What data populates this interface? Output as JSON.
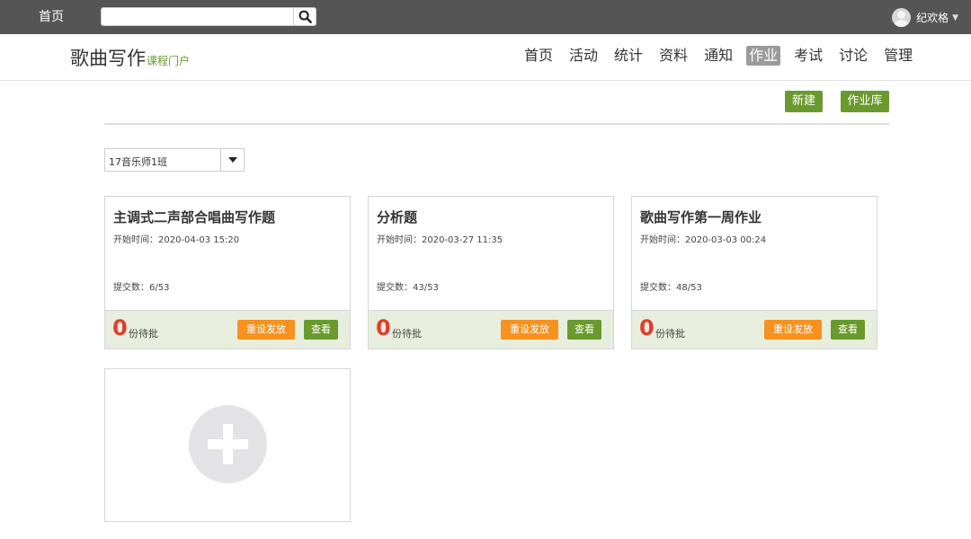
{
  "topbar": {
    "home_label": "首页",
    "search_placeholder": "",
    "user_name": "纪欢格"
  },
  "header": {
    "course_title": "歌曲写作",
    "course_subtitle": "课程门户",
    "nav": [
      "首页",
      "活动",
      "统计",
      "资料",
      "通知",
      "作业",
      "考试",
      "讨论",
      "管理"
    ],
    "active_nav": "作业"
  },
  "actions": {
    "new_label": "新建",
    "library_label": "作业库"
  },
  "class_select": {
    "value": "17音乐师1班"
  },
  "assignments": [
    {
      "title": "主调式二声部合唱曲写作题",
      "start": "开始时间：2020-04-03 15:20",
      "submitted": "提交数：6/53",
      "pending": "0",
      "pending_label": "份待批",
      "reset_label": "重设发放",
      "view_label": "查看"
    },
    {
      "title": "分析题",
      "start": "开始时间：2020-03-27 11:35",
      "submitted": "提交数：43/53",
      "pending": "0",
      "pending_label": "份待批",
      "reset_label": "重设发放",
      "view_label": "查看"
    },
    {
      "title": "歌曲写作第一周作业",
      "start": "开始时间：2020-03-03 00:24",
      "submitted": "提交数：48/53",
      "pending": "0",
      "pending_label": "份待批",
      "reset_label": "重设发放",
      "view_label": "查看"
    }
  ],
  "colors": {
    "topbar": "#555555",
    "accent_green": "#6a9a2e",
    "accent_orange": "#f7921e",
    "pending_red": "#e53b2e"
  }
}
